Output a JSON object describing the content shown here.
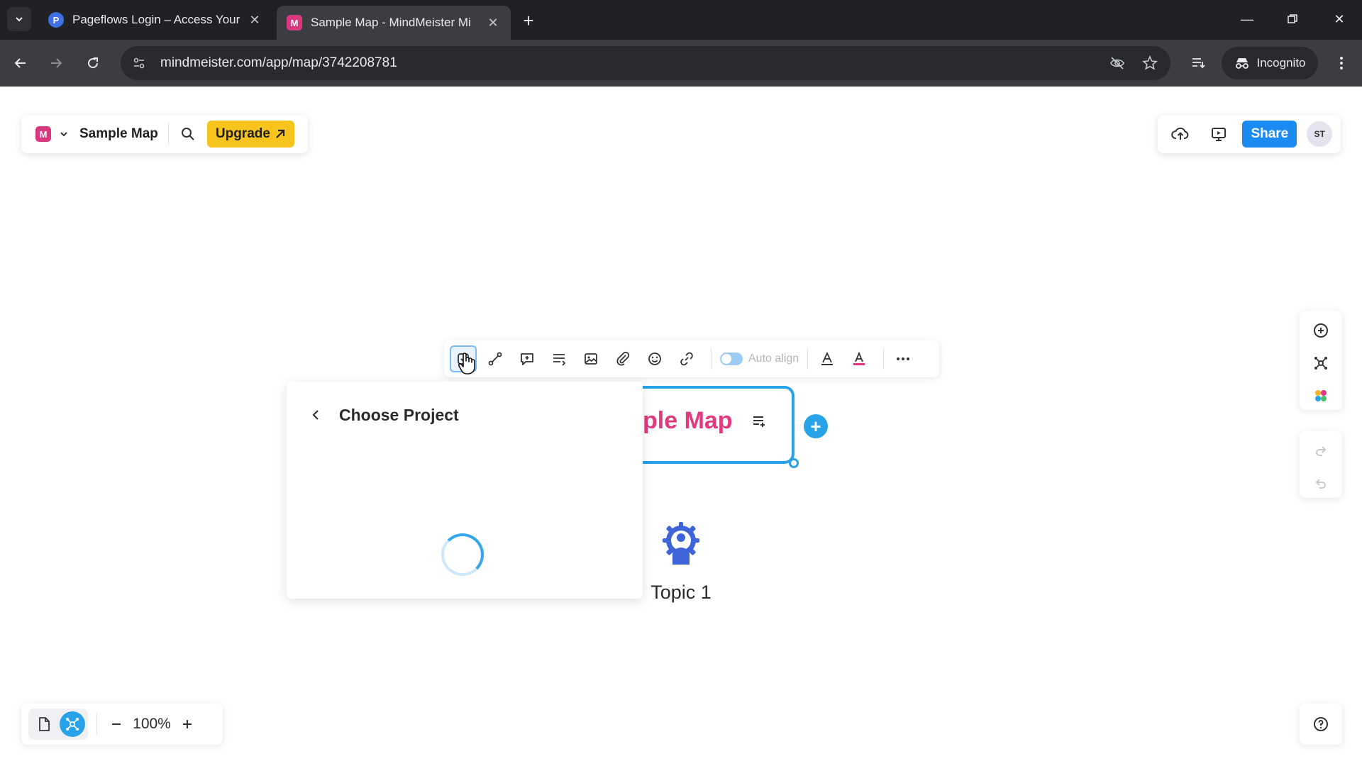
{
  "browser": {
    "tabs": [
      {
        "title": "Pageflows Login – Access Your",
        "favicon": "P",
        "active": false
      },
      {
        "title": "Sample Map - MindMeister Mi",
        "favicon": "M",
        "active": true
      }
    ],
    "url": "mindmeister.com/app/map/3742208781",
    "incognito_label": "Incognito"
  },
  "header": {
    "logo_letter": "M",
    "map_name": "Sample Map",
    "upgrade_label": "Upgrade",
    "share_label": "Share",
    "avatar_initials": "ST"
  },
  "toolbar": {
    "auto_align_label": "Auto align",
    "auto_align_on": true
  },
  "project_popup": {
    "title": "Choose Project"
  },
  "canvas": {
    "root_visible_text": "ple Map",
    "topic_label": "Topic 1"
  },
  "zoom": {
    "value": "100%"
  },
  "colors": {
    "accent_blue": "#28a3ea",
    "root_text_pink": "#e2397f",
    "upgrade_yellow": "#f7c31d",
    "share_blue": "#1b8bf2"
  }
}
